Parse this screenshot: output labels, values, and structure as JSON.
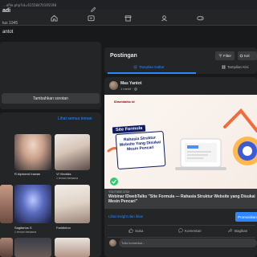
{
  "browser": {
    "url": "...ofile.php?id=61558470195198"
  },
  "topbar": {
    "icons": [
      "home-icon",
      "video-icon",
      "marketplace-icon",
      "groups-icon",
      "gaming-icon"
    ]
  },
  "header": {
    "name_partial": "antot"
  },
  "left": {
    "intro": {
      "title_partial": "adi",
      "text_partial": "tus 1945",
      "add_button": "Tambahkan sorotan"
    },
    "friends": {
      "see_all": "Lihat semua teman",
      "items": [
        {
          "name": "R Alpisend Irawan",
          "mutual": ""
        },
        {
          "name": "Vi Vinoklia",
          "mutual": "1 teman bersama"
        },
        {
          "name": "Sagitarius S",
          "mutual": "1 teman bersama"
        },
        {
          "name": "Farldinton",
          "mutual": ""
        }
      ]
    }
  },
  "main": {
    "posts_title": "Postingan",
    "filter_label": "Filter",
    "manage_label": "Kel",
    "tab_list": "Tampilan Daftar",
    "tab_grid": "Tampilan Kisi",
    "post": {
      "author": "Mas Yantot",
      "time": "1 menit · ",
      "image": {
        "logos": "iDwebtalks  id",
        "tag": "Site Formula",
        "box_text": "Rahasia Struktur Website Yang Disukai Mesin Pencari"
      },
      "link_domain": "YOUTUBE.COM",
      "link_title": "Webinar IDwebTalks \"Site Formula — Rahasia Struktur Website yang Disukai Mesin Pencari\"",
      "insight_link": "Lihat insight dan iklan",
      "promote_button": "Promosikan",
      "actions": {
        "like": "Suka",
        "comment": "Komentari",
        "share": "Bagikan"
      },
      "comment_placeholder": "Tulis komentar..."
    }
  },
  "colors": {
    "background": "#18191a",
    "card": "#242526",
    "accent": "#2d88ff",
    "text": "#e4e6eb",
    "muted": "#b0b3b8"
  }
}
